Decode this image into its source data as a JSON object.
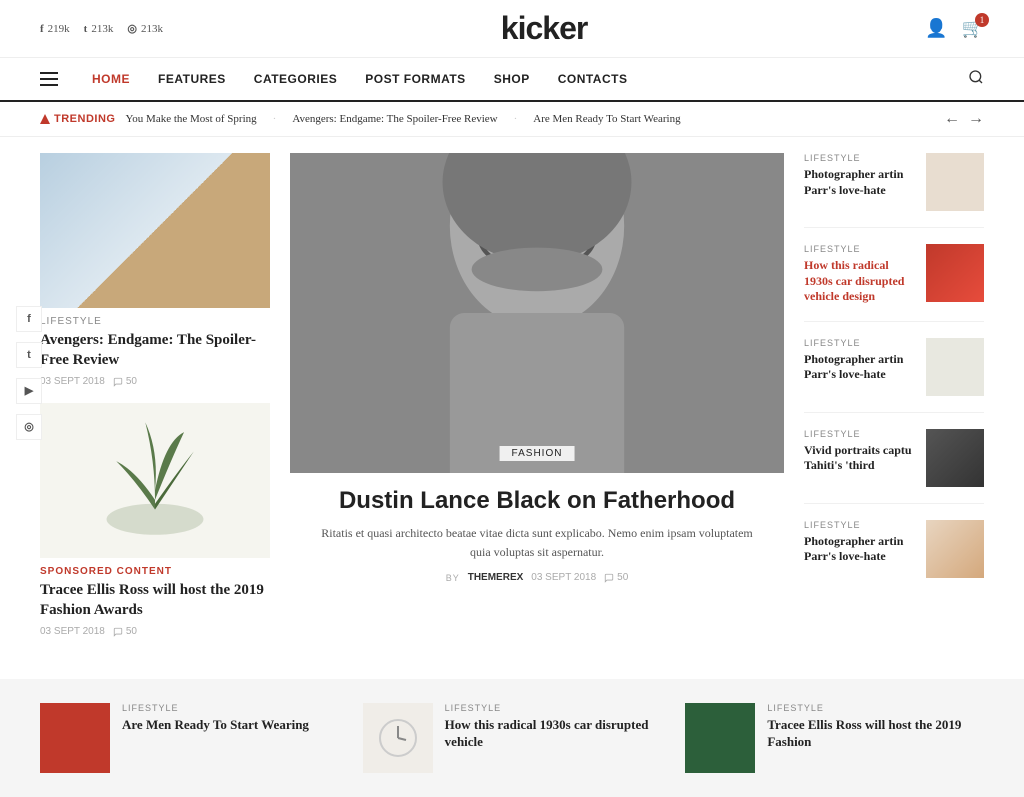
{
  "site": {
    "name": "kicker"
  },
  "topbar": {
    "social": [
      {
        "platform": "facebook",
        "icon": "f",
        "count": "219k"
      },
      {
        "platform": "twitter",
        "icon": "t",
        "count": "213k"
      },
      {
        "platform": "instagram",
        "icon": "ig",
        "count": "213k"
      }
    ],
    "cart_count": "1"
  },
  "nav": {
    "links": [
      {
        "label": "HOME",
        "active": true
      },
      {
        "label": "FEATURES",
        "active": false
      },
      {
        "label": "CATEGORIES",
        "active": false
      },
      {
        "label": "POST FORMATS",
        "active": false
      },
      {
        "label": "SHOP",
        "active": false
      },
      {
        "label": "CONTACTS",
        "active": false
      }
    ]
  },
  "trending": {
    "label": "TRENDING",
    "items": [
      "You Make the Most of Spring",
      "Avengers: Endgame: The Spoiler-Free Review",
      "Are Men Ready To Start Wearing"
    ]
  },
  "left_articles": [
    {
      "category": "LIFESTYLE",
      "title": "Avengers: Endgame: The Spoiler-Free Review",
      "date": "03 SEPT 2018",
      "comments": "50"
    },
    {
      "category": "SPONSORED CONTENT",
      "category_sponsored": true,
      "title": "Tracee Ellis Ross will host the 2019 Fashion Awards",
      "date": "03 SEPT 2018",
      "comments": "50"
    }
  ],
  "hero": {
    "category": "FASHION",
    "title": "Dustin Lance Black on Fatherhood",
    "description": "Ritatis et quasi architecto beatae vitae dicta sunt explicabo. Nemo enim ipsam voluptatem quia voluptas sit aspernatur.",
    "by_label": "BY",
    "author": "THEMEREX",
    "date": "03 SEPT 2018",
    "comments": "50"
  },
  "sidebar_articles": [
    {
      "category": "LIFESTYLE",
      "title": "Photographer artin Parr's love-hate",
      "link": false
    },
    {
      "category": "LIFESTYLE",
      "title": "How this radical 1930s car disrupted vehicle design",
      "link": true
    },
    {
      "category": "LIFESTYLE",
      "title": "Photographer artin Parr's love-hate",
      "link": false
    },
    {
      "category": "LIFESTYLE",
      "title": "Vivid portraits captu Tahiti's 'third",
      "link": false
    },
    {
      "category": "LIFESTYLE",
      "title": "Photographer artin Parr's love-hate",
      "link": false
    }
  ],
  "bottom_articles": [
    {
      "category": "LIFESTYLE",
      "title": "Are Men Ready To Start Wearing"
    },
    {
      "category": "LIFESTYLE",
      "title": "How this radical 1930s car disrupted vehicle"
    },
    {
      "category": "LIFESTYLE",
      "title": "Tracee Ellis Ross will host the 2019 Fashion"
    }
  ],
  "social_sidebar": [
    {
      "platform": "facebook",
      "label": "f"
    },
    {
      "platform": "twitter",
      "label": "t"
    },
    {
      "platform": "youtube",
      "label": "▶"
    },
    {
      "platform": "instagram",
      "label": "◎"
    }
  ]
}
